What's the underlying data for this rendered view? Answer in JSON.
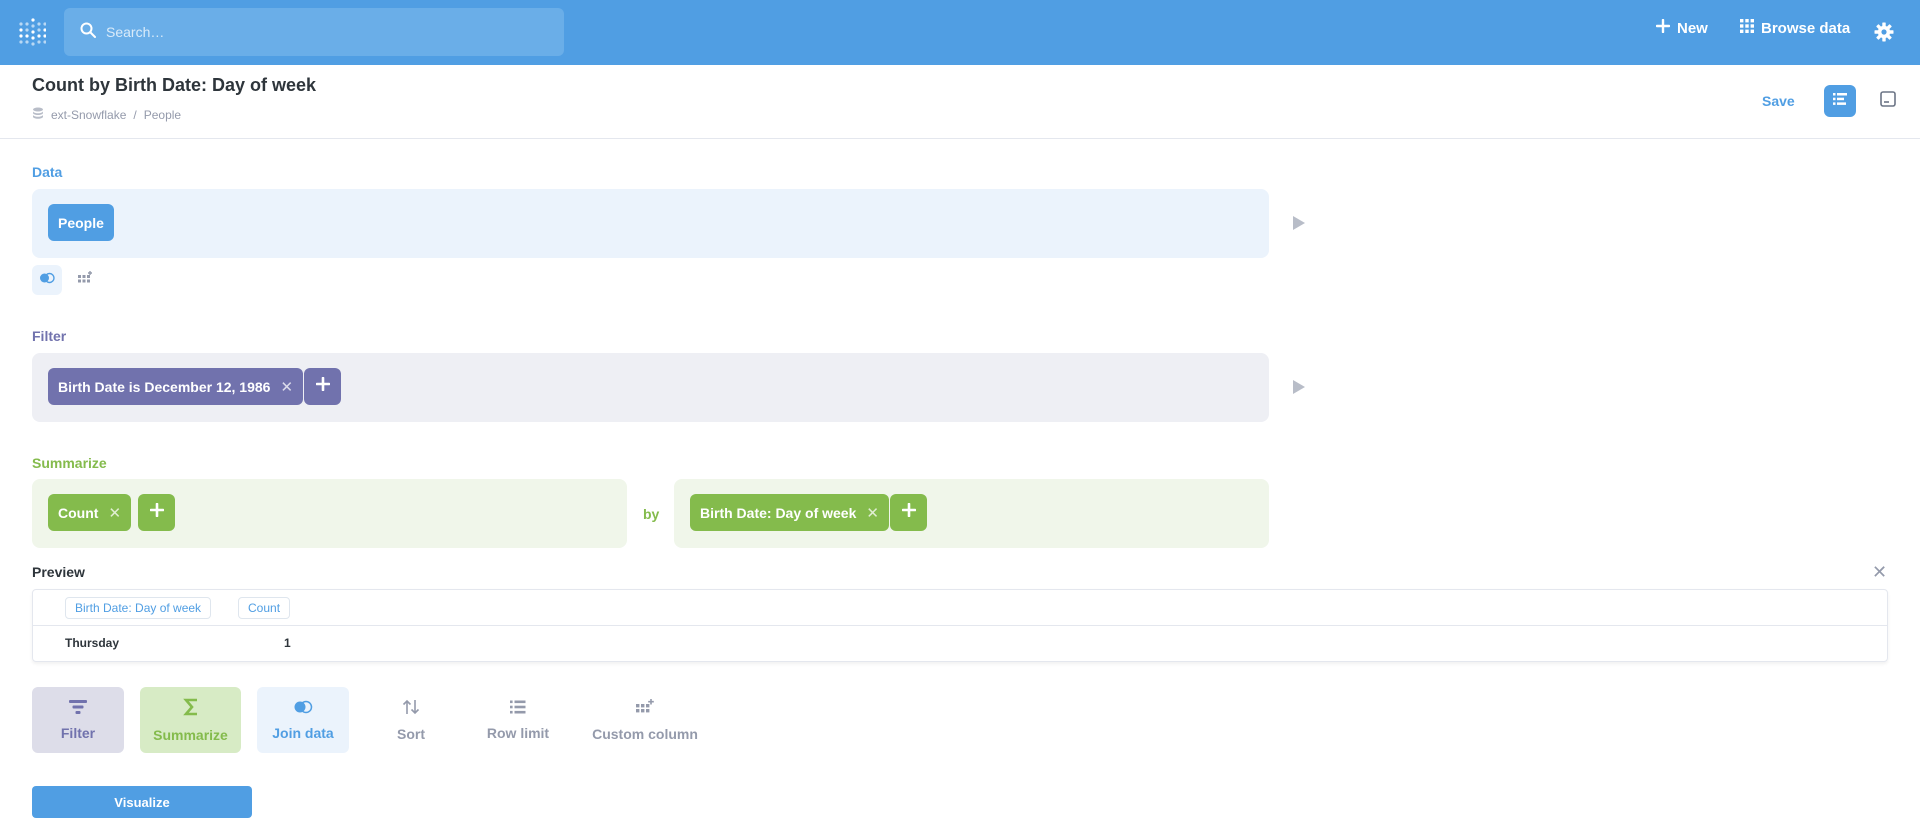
{
  "nav": {
    "search_placeholder": "Search…",
    "new_label": "New",
    "browse_label": "Browse data"
  },
  "header": {
    "title": "Count by Birth Date: Day of week",
    "breadcrumb": [
      "ext-Snowflake",
      "/",
      "People"
    ],
    "save_label": "Save"
  },
  "notebook": {
    "data": {
      "label": "Data",
      "table": "People"
    },
    "filter": {
      "label": "Filter",
      "filters": [
        "Birth Date is December 12, 1986"
      ]
    },
    "summarize": {
      "label": "Summarize",
      "metrics": [
        "Count"
      ],
      "by_label": "by",
      "breakouts": [
        "Birth Date: Day of week"
      ]
    }
  },
  "preview": {
    "label": "Preview",
    "columns": [
      "Birth Date: Day of week",
      "Count"
    ],
    "rows": [
      [
        "Thursday",
        "1"
      ]
    ]
  },
  "actions": [
    {
      "label": "Filter",
      "icon": "filter-icon"
    },
    {
      "label": "Summarize",
      "icon": "sigma-icon"
    },
    {
      "label": "Join data",
      "icon": "join-icon"
    },
    {
      "label": "Sort",
      "icon": "sort-icon"
    },
    {
      "label": "Row limit",
      "icon": "list-icon"
    },
    {
      "label": "Custom column",
      "icon": "add-column-icon"
    }
  ],
  "visualize_label": "Visualize",
  "colors": {
    "brand": "#509ee3",
    "filter": "#7172ad",
    "summarize": "#84bb4c",
    "text_dark": "#2e353b",
    "text_light": "#949aab"
  }
}
